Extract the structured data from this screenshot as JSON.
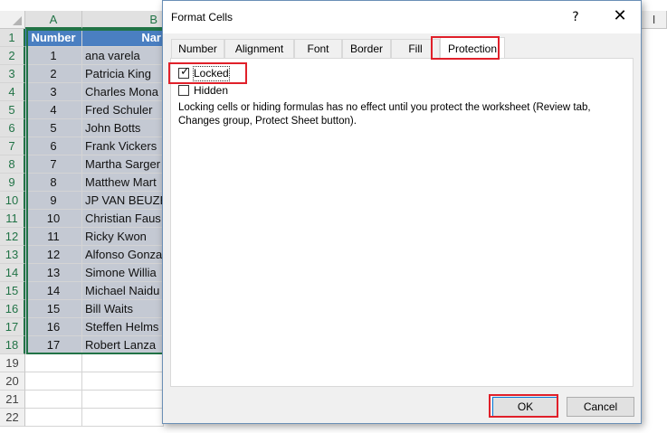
{
  "columns": [
    "A",
    "B",
    "I"
  ],
  "header_row": {
    "number": "Number",
    "name": "Nar"
  },
  "rows": [
    {
      "rownum": "1"
    },
    {
      "rownum": "2",
      "num": "1",
      "name": "ana varela"
    },
    {
      "rownum": "3",
      "num": "2",
      "name": "Patricia King"
    },
    {
      "rownum": "4",
      "num": "3",
      "name": "Charles Mona"
    },
    {
      "rownum": "5",
      "num": "4",
      "name": "Fred Schuler"
    },
    {
      "rownum": "6",
      "num": "5",
      "name": "John Botts"
    },
    {
      "rownum": "7",
      "num": "6",
      "name": "Frank Vickers"
    },
    {
      "rownum": "8",
      "num": "7",
      "name": "Martha Sarger"
    },
    {
      "rownum": "9",
      "num": "8",
      "name": "Matthew Mart"
    },
    {
      "rownum": "10",
      "num": "9",
      "name": "JP VAN BEUZE"
    },
    {
      "rownum": "11",
      "num": "10",
      "name": "Christian Faus"
    },
    {
      "rownum": "12",
      "num": "11",
      "name": "Ricky Kwon"
    },
    {
      "rownum": "13",
      "num": "12",
      "name": "Alfonso Gonza"
    },
    {
      "rownum": "14",
      "num": "13",
      "name": "Simone Willia"
    },
    {
      "rownum": "15",
      "num": "14",
      "name": "Michael Naidu"
    },
    {
      "rownum": "16",
      "num": "15",
      "name": "Bill Waits"
    },
    {
      "rownum": "17",
      "num": "16",
      "name": "Steffen Helms"
    },
    {
      "rownum": "18",
      "num": "17",
      "name": "Robert Lanza"
    },
    {
      "rownum": "19"
    },
    {
      "rownum": "20"
    },
    {
      "rownum": "21"
    },
    {
      "rownum": "22"
    }
  ],
  "dialog": {
    "title": "Format Cells",
    "help_label": "?",
    "close_label": "✕",
    "tabs": [
      "Number",
      "Alignment",
      "Font",
      "Border",
      "Fill",
      "Protection"
    ],
    "active_tab": "Protection",
    "locked_label": "Locked",
    "locked_checked": true,
    "hidden_label": "Hidden",
    "hidden_checked": false,
    "note": "Locking cells or hiding formulas has no effect until you protect the worksheet (Review tab, Changes group, Protect Sheet button).",
    "ok_label": "OK",
    "cancel_label": "Cancel"
  },
  "colors": {
    "header_blue": "#4a7fc1",
    "data_gray": "#c4c9d3",
    "selection_green": "#217346",
    "highlight_red": "#e0202a"
  }
}
